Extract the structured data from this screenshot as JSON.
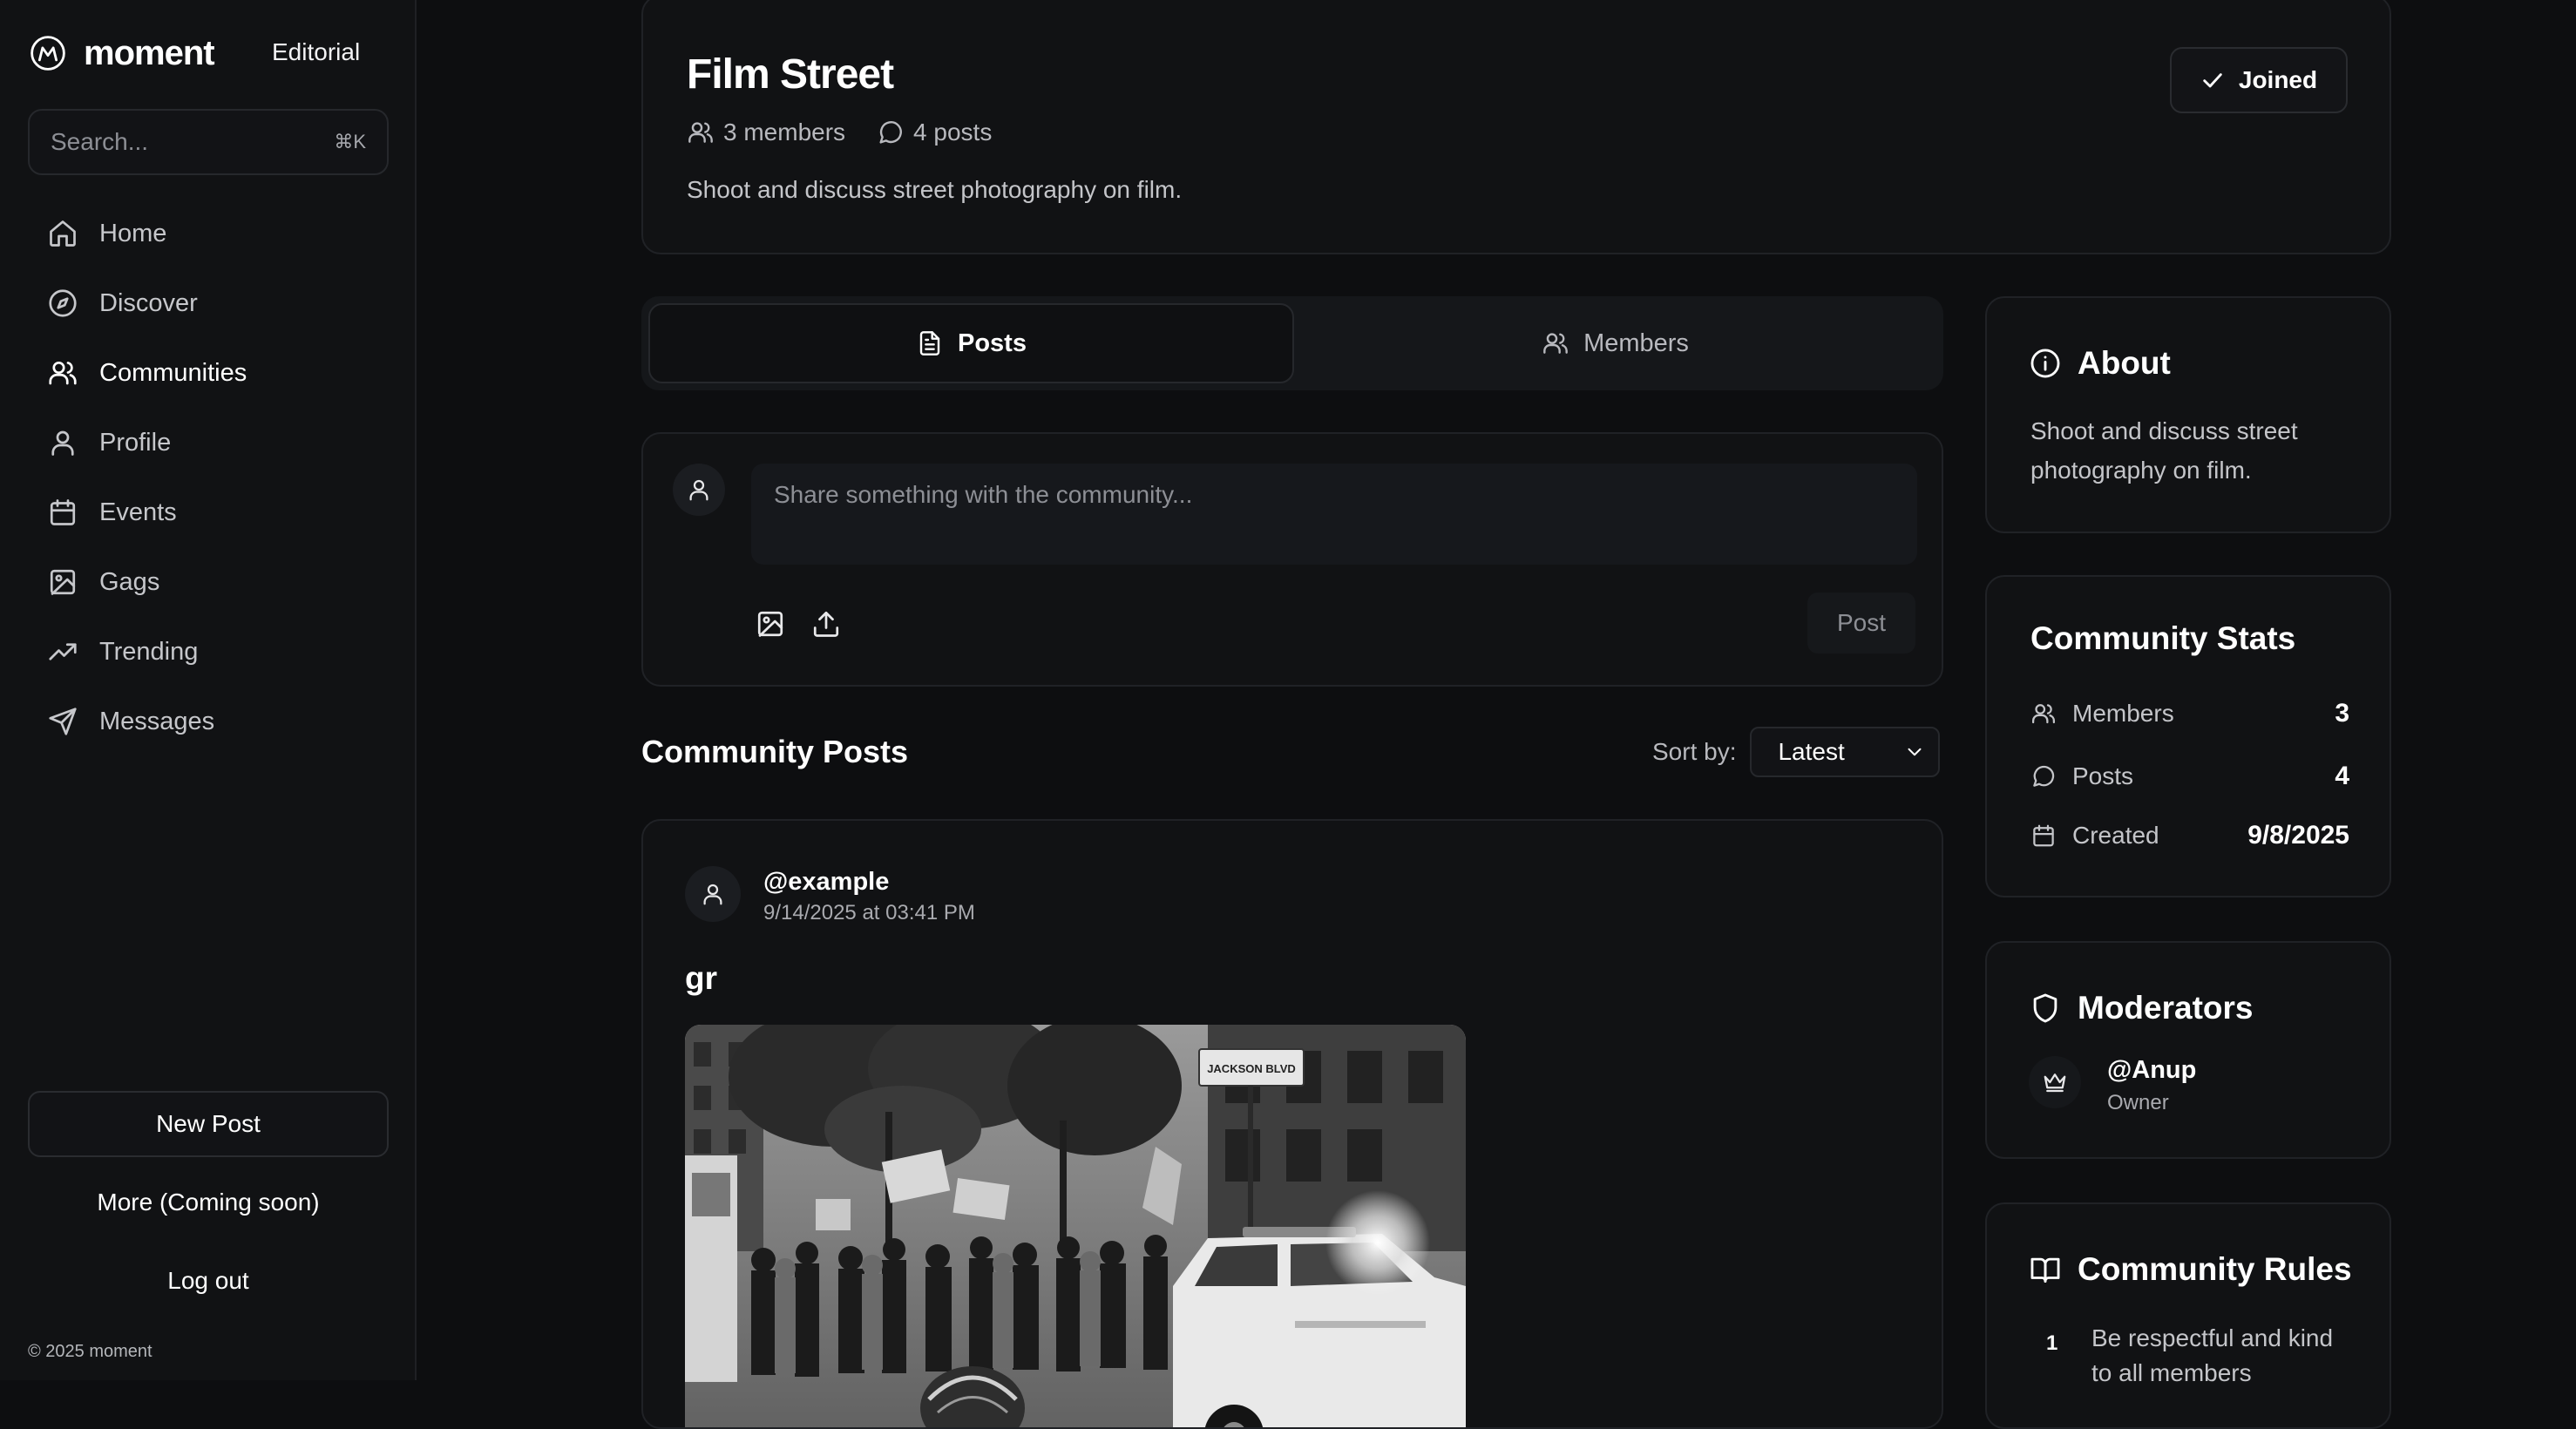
{
  "sidebar": {
    "brand": "moment",
    "editorial": "Editorial",
    "search_placeholder": "Search...",
    "search_shortcut": "⌘K",
    "nav": [
      {
        "label": "Home",
        "icon": "home-icon"
      },
      {
        "label": "Discover",
        "icon": "compass-icon"
      },
      {
        "label": "Communities",
        "icon": "users-icon",
        "active": true
      },
      {
        "label": "Profile",
        "icon": "user-icon"
      },
      {
        "label": "Events",
        "icon": "calendar-icon"
      },
      {
        "label": "Gags",
        "icon": "image-icon"
      },
      {
        "label": "Trending",
        "icon": "trending-up-icon"
      },
      {
        "label": "Messages",
        "icon": "send-icon"
      }
    ],
    "new_post": "New Post",
    "more": "More (Coming soon)",
    "logout": "Log out",
    "copyright": "© 2025 moment"
  },
  "community": {
    "name": "Film Street",
    "members_text": "3 members",
    "posts_text": "4 posts",
    "description": "Shoot and discuss street photography on film.",
    "joined_label": "Joined"
  },
  "tabs": {
    "posts": "Posts",
    "members": "Members",
    "active": "posts"
  },
  "composer": {
    "placeholder": "Share something with the community...",
    "post_label": "Post"
  },
  "feed": {
    "heading": "Community Posts",
    "sort_label": "Sort by:",
    "sort_value": "Latest",
    "posts": [
      {
        "author": "@example",
        "time": "9/14/2025 at 03:41 PM",
        "title": "gr",
        "sign_text": "JACKSON BLVD"
      }
    ]
  },
  "about": {
    "title": "About",
    "text": "Shoot and discuss street photography on film."
  },
  "stats": {
    "title": "Community Stats",
    "members_label": "Members",
    "members_value": "3",
    "posts_label": "Posts",
    "posts_value": "4",
    "created_label": "Created",
    "created_value": "9/8/2025"
  },
  "moderators": {
    "title": "Moderators",
    "list": [
      {
        "name": "@Anup",
        "role": "Owner"
      }
    ]
  },
  "rules": {
    "title": "Community Rules",
    "list": [
      {
        "num": "1",
        "text": "Be respectful and kind to all members"
      }
    ]
  },
  "colors": {
    "background": "#0d0e10",
    "card": "#111214",
    "border": "#202226",
    "text_primary": "#ffffff",
    "text_muted": "#b8b9be"
  }
}
